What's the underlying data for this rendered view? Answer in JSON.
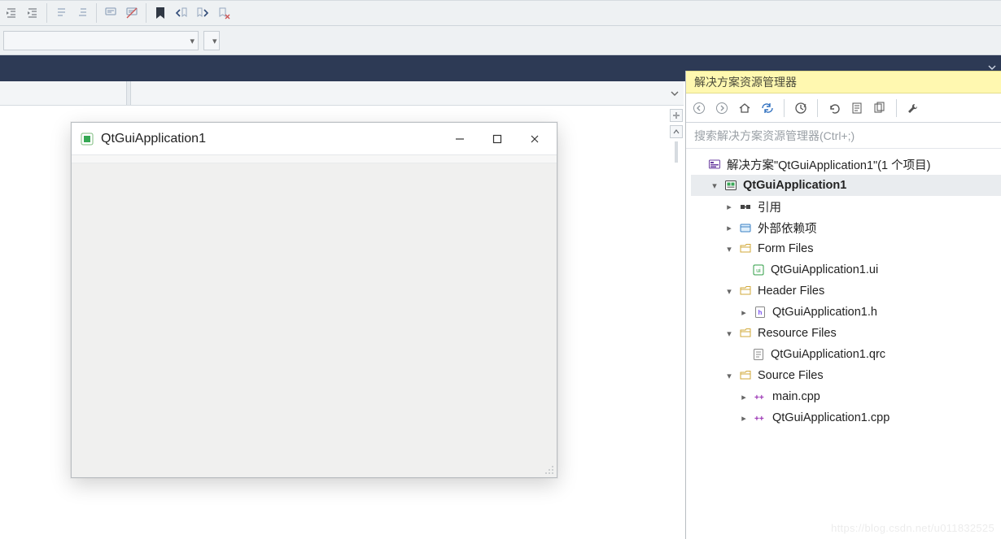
{
  "toolbar": {
    "buttons": [
      "uncomment-icon",
      "separator",
      "bookmark-toggle-icon",
      "bookmark-prev-icon",
      "bookmark-next-icon",
      "bookmark-clear-icon"
    ]
  },
  "window": {
    "title": "QtGuiApplication1",
    "controls": {
      "min": "—",
      "max": "□",
      "close": "×"
    }
  },
  "solution_explorer": {
    "title": "解决方案资源管理器",
    "search_placeholder": "搜索解决方案资源管理器(Ctrl+;)",
    "toolbar_buttons": [
      "nav-back-icon",
      "nav-forward-icon",
      "home-icon",
      "sync-icon",
      "separator",
      "history-icon",
      "separator",
      "collapse-icon",
      "props-icon",
      "show-all-icon",
      "separator",
      "wrench-icon"
    ],
    "root": {
      "label": "解决方案\"QtGuiApplication1\"(1 个项目)",
      "project": {
        "label": "QtGuiApplication1",
        "children": [
          {
            "kind": "folder",
            "label": "引用",
            "expanded": false,
            "icon": "refs-icon"
          },
          {
            "kind": "folder",
            "label": "外部依赖项",
            "expanded": false,
            "icon": "extdep-icon"
          },
          {
            "kind": "folder",
            "label": "Form Files",
            "expanded": true,
            "icon": "filter-icon",
            "children": [
              {
                "kind": "file",
                "label": "QtGuiApplication1.ui",
                "icon": "ui-icon"
              }
            ]
          },
          {
            "kind": "folder",
            "label": "Header Files",
            "expanded": true,
            "icon": "filter-icon",
            "children": [
              {
                "kind": "file",
                "label": "QtGuiApplication1.h",
                "icon": "h-icon",
                "has_children": true
              }
            ]
          },
          {
            "kind": "folder",
            "label": "Resource Files",
            "expanded": true,
            "icon": "filter-icon",
            "children": [
              {
                "kind": "file",
                "label": "QtGuiApplication1.qrc",
                "icon": "qrc-icon"
              }
            ]
          },
          {
            "kind": "folder",
            "label": "Source Files",
            "expanded": true,
            "icon": "filter-icon",
            "children": [
              {
                "kind": "file",
                "label": "main.cpp",
                "icon": "cpp-icon",
                "has_children": true
              },
              {
                "kind": "file",
                "label": "QtGuiApplication1.cpp",
                "icon": "cpp-icon",
                "has_children": true
              }
            ]
          }
        ]
      }
    }
  },
  "watermark": "https://blog.csdn.net/u011832525"
}
